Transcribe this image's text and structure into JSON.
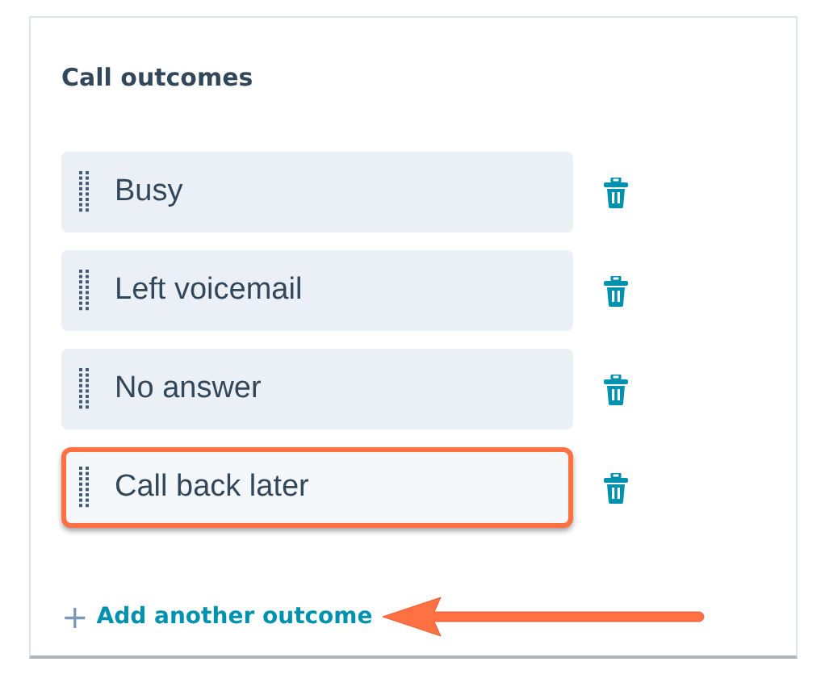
{
  "title": "Call outcomes",
  "outcomes": [
    {
      "label": "Busy",
      "highlighted": false
    },
    {
      "label": "Left voicemail",
      "highlighted": false
    },
    {
      "label": "No answer",
      "highlighted": false
    },
    {
      "label": "Call back later",
      "highlighted": true
    }
  ],
  "add_link": {
    "icon": "+",
    "label": "Add another outcome",
    "arrow": true
  }
}
